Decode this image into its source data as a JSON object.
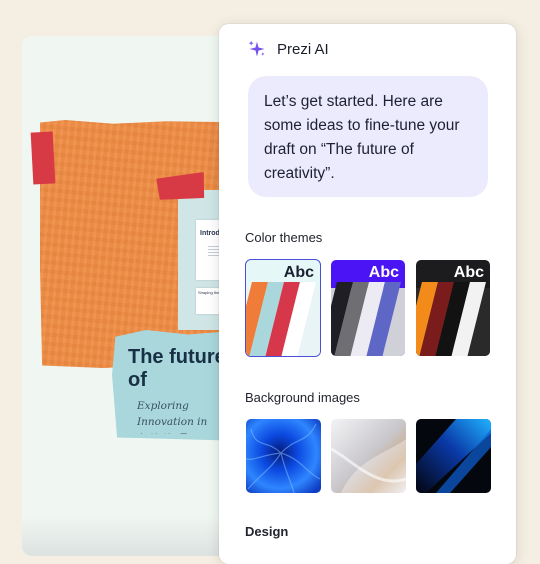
{
  "canvas": {
    "slide_title": "The future of\ncreativity",
    "slide_subtitle": "Exploring Innovation in\nArtistic Expression",
    "mini_slide_title": "Introduction",
    "mini_slide_card": "Shaping the Time"
  },
  "panel": {
    "title": "Prezi AI",
    "icon": "sparkle-icon",
    "message": "Let’s get started. Here are some ideas to fine-tune your draft on “The future of creativity”.",
    "sections": {
      "color_themes": "Color themes",
      "background_images": "Background images",
      "design": "Design"
    },
    "themes": [
      {
        "label": "Abc",
        "name": "light-teal",
        "header_color": "#e6f7f8",
        "text_color": "#1b2030",
        "stripes": [
          "#f07c3a",
          "#a9d7db",
          "#d6374b",
          "#ffffff",
          "#e9f4f6"
        ],
        "selected": true
      },
      {
        "label": "Abc",
        "name": "purple",
        "header_color": "#4b14f5",
        "text_color": "#ffffff",
        "stripes": [
          "#1e1e24",
          "#6f6f73",
          "#eceaf3",
          "#5e66c6",
          "#cfd0d8"
        ],
        "selected": false
      },
      {
        "label": "Abc",
        "name": "dark",
        "header_color": "#1c1c1e",
        "text_color": "#ffffff",
        "stripes": [
          "#f38b1a",
          "#7a1c1c",
          "#121212",
          "#f2f2f2",
          "#2a2a2a"
        ],
        "selected": false
      }
    ],
    "backgrounds": [
      {
        "name": "blue-flower-image"
      },
      {
        "name": "silver-abstract-image"
      },
      {
        "name": "dark-blue-light-image"
      }
    ]
  }
}
